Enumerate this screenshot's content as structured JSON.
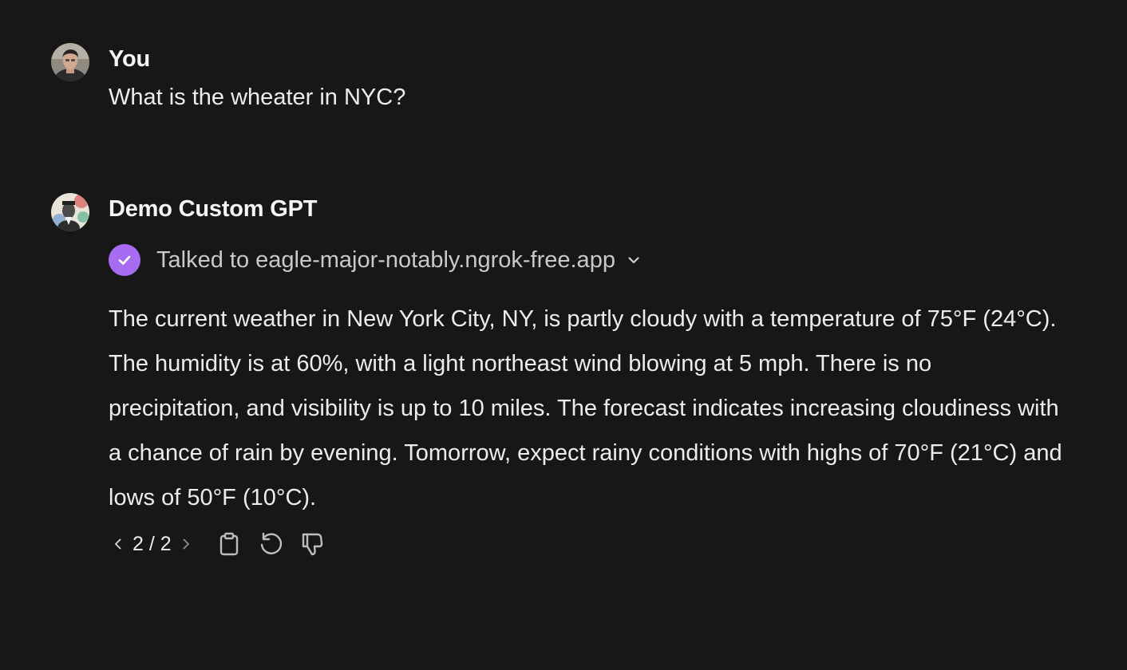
{
  "conversation": {
    "user_message": {
      "author": "You",
      "text": "What is the wheater in NYC?"
    },
    "assistant_message": {
      "author": "Demo Custom GPT",
      "tool_status": "Talked to eagle-major-notably.ngrok-free.app",
      "text": "The current weather in New York City, NY, is partly cloudy with a temperature of 75°F (24°C). The humidity is at 60%, with a light northeast wind blowing at 5 mph. There is no precipitation, and visibility is up to 10 miles. The forecast indicates increasing cloudiness with a chance of rain by evening. Tomorrow, expect rainy conditions with highs of 70°F (21°C) and lows of 50°F (10°C).",
      "pager": "2 / 2"
    }
  },
  "icons": {
    "user_avatar": "user-avatar",
    "gpt_avatar": "gpt-avatar",
    "tool_check": "check-icon",
    "tool_expand": "chevron-down-icon",
    "prev": "chevron-left-icon",
    "next": "chevron-right-icon",
    "copy": "clipboard-icon",
    "regenerate": "regenerate-icon",
    "dislike": "thumbs-down-icon"
  },
  "colors": {
    "background": "#171717",
    "text": "#ececec",
    "tool_badge": "#a76cf2",
    "muted_text": "#c9c9c9"
  }
}
